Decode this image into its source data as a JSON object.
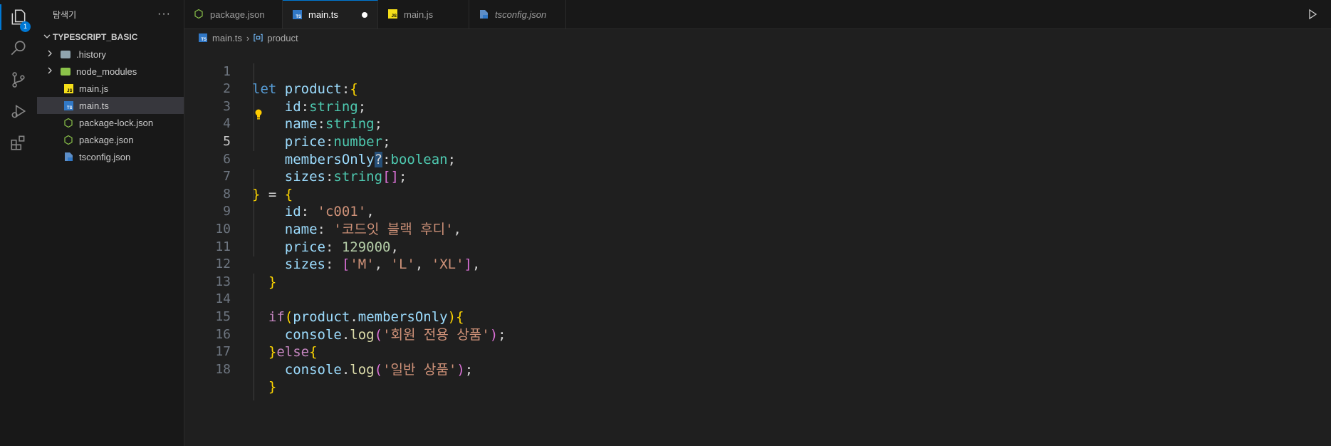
{
  "activity": {
    "badge": "1"
  },
  "sidebar": {
    "title": "탐색기",
    "more": "···",
    "project": "TYPESCRIPT_BASIC",
    "items": [
      {
        "label": ".history",
        "kind": "folder"
      },
      {
        "label": "node_modules",
        "kind": "folder-node"
      },
      {
        "label": "main.js",
        "kind": "js"
      },
      {
        "label": "main.ts",
        "kind": "ts",
        "selected": true
      },
      {
        "label": "package-lock.json",
        "kind": "node"
      },
      {
        "label": "package.json",
        "kind": "node"
      },
      {
        "label": "tsconfig.json",
        "kind": "tsconfig"
      }
    ]
  },
  "tabs": [
    {
      "label": "package.json"
    },
    {
      "label": "main.ts"
    },
    {
      "label": "main.js"
    },
    {
      "label": "tsconfig.json"
    }
  ],
  "breadcrumb": {
    "file": "main.ts",
    "symbol": "product"
  },
  "code": {
    "l1": [
      "let",
      "product",
      ":",
      "{"
    ],
    "l2": [
      "id",
      ":",
      "string",
      ";"
    ],
    "l3": [
      "name",
      ":",
      "string",
      ";"
    ],
    "l4": [
      "price",
      ":",
      "number",
      ";"
    ],
    "l5": [
      "membersOnly",
      "?",
      ":",
      "boolean",
      ";"
    ],
    "l6": [
      "sizes",
      ":",
      "string",
      "[]",
      ";"
    ],
    "l7": [
      "}",
      " = ",
      "{"
    ],
    "l8": [
      "id",
      ": ",
      "'c001'",
      ","
    ],
    "l9": [
      "name",
      ": ",
      "'코드잇 블랙 후디'",
      ","
    ],
    "l10": [
      "price",
      ": ",
      "129000",
      ","
    ],
    "l11": [
      "sizes",
      ": ",
      "[",
      "'M'",
      ", ",
      "'L'",
      ", ",
      "'XL'",
      "]",
      ","
    ],
    "l12": [
      "}"
    ],
    "l14": [
      "if",
      "(",
      "product",
      ".",
      "membersOnly",
      ")",
      "{"
    ],
    "l15": [
      "console",
      ".",
      "log",
      "(",
      "'회원 전용 상품'",
      ")",
      ";"
    ],
    "l16": [
      "}",
      "else",
      "{"
    ],
    "l17": [
      "console",
      ".",
      "log",
      "(",
      "'일반 상품'",
      ")",
      ";"
    ],
    "l18": [
      "}"
    ]
  },
  "line_numbers": [
    "1",
    "2",
    "3",
    "4",
    "5",
    "6",
    "7",
    "8",
    "9",
    "10",
    "11",
    "12",
    "13",
    "14",
    "15",
    "16",
    "17",
    "18"
  ]
}
